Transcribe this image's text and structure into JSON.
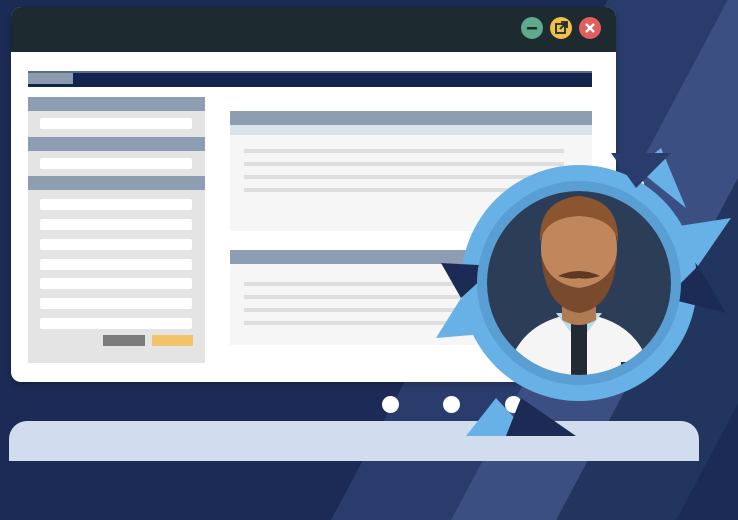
{
  "window": {
    "controls": [
      "minimize",
      "popout",
      "close"
    ],
    "colors": {
      "minimize": "#5ea98c",
      "popout": "#f1c048",
      "close": "#e25d5d",
      "titlebar": "#1d2a30",
      "header": "#13244f"
    }
  },
  "illustration": {
    "subject": "person-avatar",
    "sync_arrows_color": "#67b1e6",
    "background_color": "#1b2b55"
  },
  "carousel": {
    "count": 3,
    "active_index": 0
  }
}
